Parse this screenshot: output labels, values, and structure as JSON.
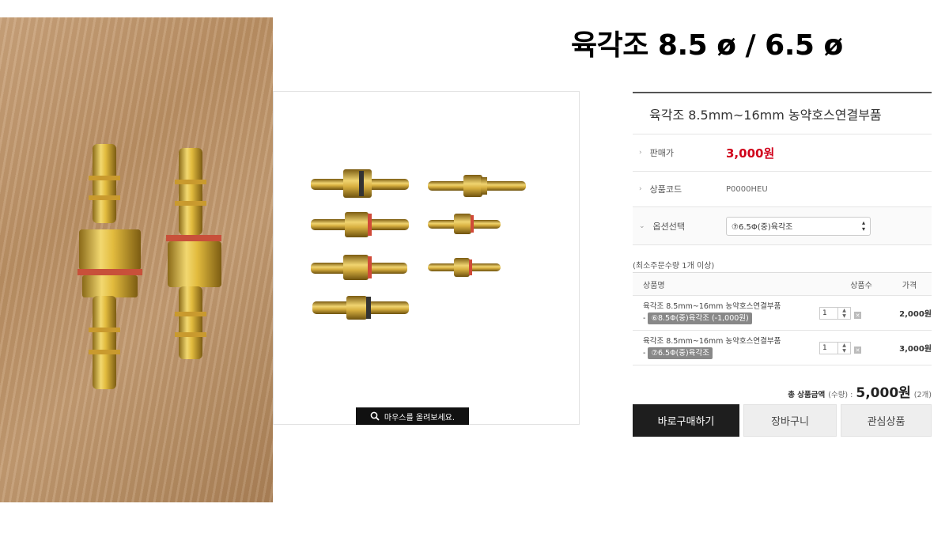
{
  "heading": {
    "title": "육각조 8.5 ø / 6.5 ø"
  },
  "zoom_hint": {
    "label": "마우스를 올려보세요.",
    "icon": "magnifier-icon"
  },
  "product": {
    "name": "육각조 8.5mm~16mm 농약호스연결부품",
    "price_label": "판매가",
    "price": "3,000원",
    "code_label": "상품코드",
    "code": "P0000HEU",
    "option_label": "옵션선택",
    "option_selected": "⑦6.5Φ(중)육각조"
  },
  "min_order_note": "(최소주문수량 1개 이상)",
  "order_table": {
    "headers": [
      "상품명",
      "상품수",
      "가격"
    ],
    "rows": [
      {
        "name": "육각조 8.5mm~16mm 농약호스연결부품",
        "dash": "-",
        "option": "⑥8.5Φ(중)육각조 (-1,000원)",
        "qty": "1",
        "price": "2,000원"
      },
      {
        "name": "육각조 8.5mm~16mm 농약호스연결부품",
        "dash": "-",
        "option": "⑦6.5Φ(중)육각조",
        "qty": "1",
        "price": "3,000원"
      }
    ]
  },
  "total": {
    "label": "총 상품금액",
    "sub": "(수량) :",
    "amount": "5,000원",
    "count": "(2개)"
  },
  "buttons": {
    "buy": "바로구매하기",
    "cart": "장바구니",
    "wish": "관심상품"
  },
  "colors": {
    "price": "#d0021b",
    "buy_bg": "#1e1e1e",
    "brass": "#c9a227"
  }
}
